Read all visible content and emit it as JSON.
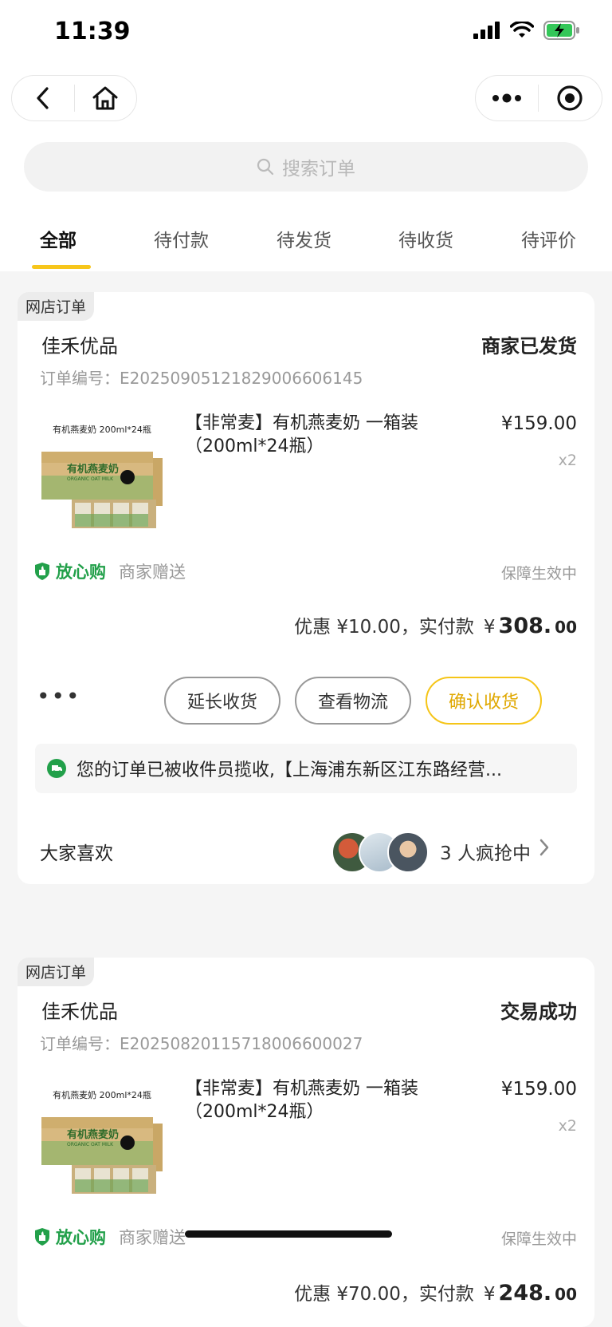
{
  "status_bar": {
    "time": "11:39"
  },
  "search": {
    "placeholder": "搜索订单"
  },
  "tabs": [
    {
      "label": "全部"
    },
    {
      "label": "待付款"
    },
    {
      "label": "待发货"
    },
    {
      "label": "待收货"
    },
    {
      "label": "待评价"
    }
  ],
  "orders": [
    {
      "tag": "网店订单",
      "shop": "佳禾优品",
      "status": "商家已发货",
      "order_no": "订单编号：E20250905121829006606145",
      "item_title": "【非常麦】有机燕麦奶 一箱装（200ml*24瓶）",
      "price": "¥159.00",
      "qty": "x2",
      "assure": "放心购",
      "gift": "商家赠送",
      "assure_status": "保障生效中",
      "discount": "优惠 ¥10.00，实付款",
      "yen": "¥",
      "pay_int": "308.",
      "pay_dec": "00",
      "more": "•••",
      "btn_extend": "延长收货",
      "btn_logistics": "查看物流",
      "btn_confirm": "确认收货",
      "logistics_text": "您的订单已被收件员揽收,【上海浦东新区江东路经营..."
    },
    {
      "tag": "网店订单",
      "shop": "佳禾优品",
      "status": "交易成功",
      "order_no": "订单编号：E20250820115718006600027",
      "item_title": "【非常麦】有机燕麦奶 一箱装（200ml*24瓶）",
      "price": "¥159.00",
      "qty": "x2",
      "assure": "放心购",
      "gift": "商家赠送",
      "assure_status": "保障生效中",
      "discount": "优惠 ¥70.00，实付款",
      "yen": "¥",
      "pay_int": "248.",
      "pay_dec": "00"
    }
  ],
  "likes": {
    "label": "大家喜欢",
    "count": "3 人疯抢中"
  },
  "product_image": {
    "line1": "有机燕麦奶 200ml*24瓶",
    "brand": "有机燕麦奶",
    "brand_en": "ORGANIC OAT MILK"
  },
  "colors": {
    "accent": "#f7c61b",
    "assure_green": "#22a04a",
    "confirm_text": "#e0a800"
  }
}
